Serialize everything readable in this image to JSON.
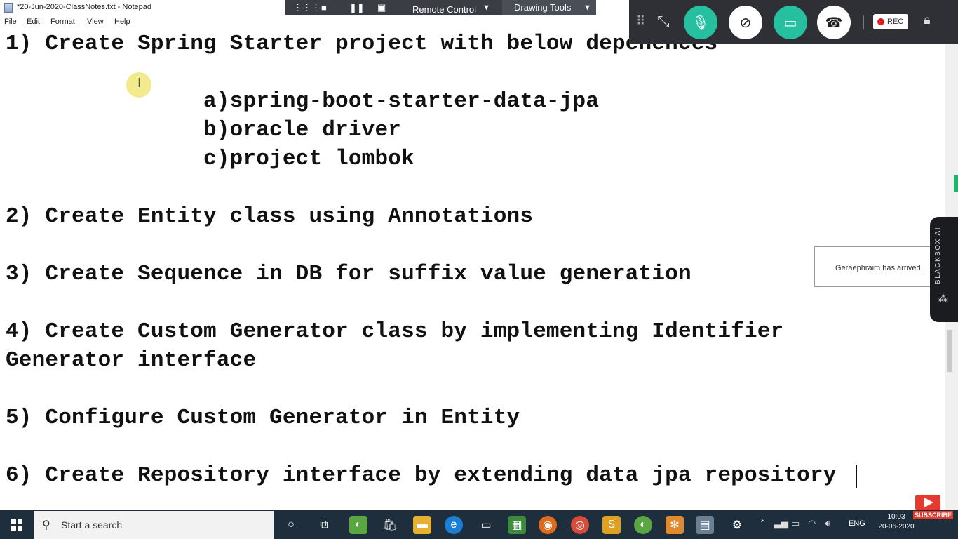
{
  "window": {
    "title": "*20-Jun-2020-ClassNotes.txt - Notepad",
    "menu": [
      "File",
      "Edit",
      "Format",
      "View",
      "Help"
    ]
  },
  "editor": {
    "lines": [
      "1) Create Spring Starter project with below depenences",
      "               a)spring-boot-starter-data-jpa",
      "               b)oracle driver",
      "               c)project lombok",
      "2) Create Entity class using Annotations",
      "3) Create Sequence in DB for suffix value generation",
      "4) Create Custom Generator class by implementing Identifier",
      "Generator interface",
      "5) Configure Custom Generator in Entity",
      "6) Create Repository interface by extending data jpa repository"
    ]
  },
  "remote_toolbar": {
    "remote_control": "Remote Control",
    "drawing_tools": "Drawing Tools"
  },
  "meeting": {
    "rec_label": "REC"
  },
  "notification": {
    "text": "Geraephraim has arrived."
  },
  "blackbox": {
    "label": "BLACKBOX AI"
  },
  "taskbar": {
    "search_placeholder": "Start a search",
    "language": "ENG",
    "time": "10:03",
    "date": "20-06-2020"
  },
  "subscribe": {
    "label": "SUBSCRIBE"
  },
  "colors": {
    "accent_green": "#20b36a",
    "taskbar": "#1e2e3c",
    "record_red": "#e02020"
  }
}
